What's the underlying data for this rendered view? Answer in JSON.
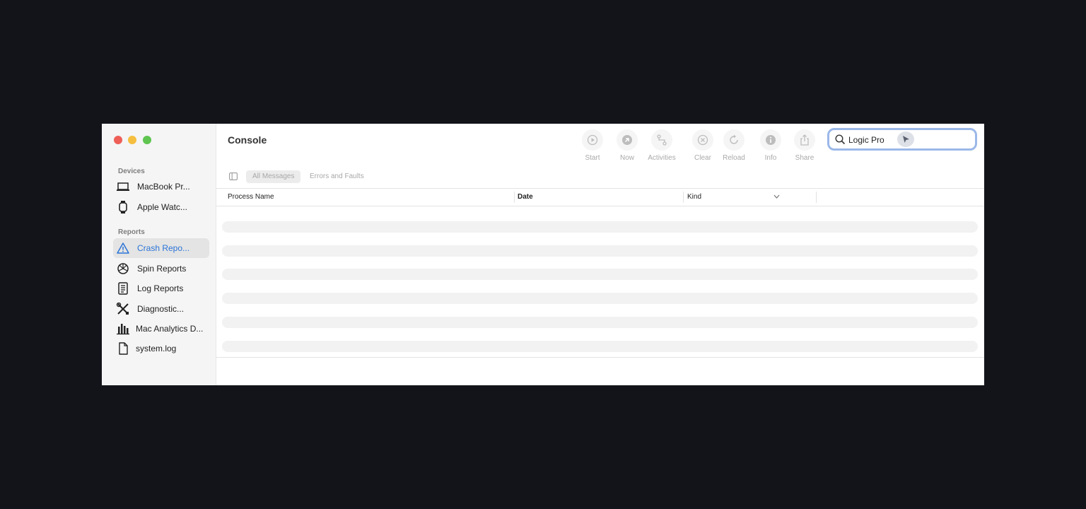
{
  "window": {
    "title": "Console"
  },
  "sidebar": {
    "devices_label": "Devices",
    "devices": [
      {
        "label": "MacBook Pr...",
        "icon": "laptop-icon"
      },
      {
        "label": "Apple Watc...",
        "icon": "watch-icon"
      }
    ],
    "reports_label": "Reports",
    "reports": [
      {
        "label": "Crash Repo...",
        "icon": "warning-triangle-icon",
        "selected": true
      },
      {
        "label": "Spin Reports",
        "icon": "spin-wheel-icon"
      },
      {
        "label": "Log Reports",
        "icon": "document-list-icon"
      },
      {
        "label": "Diagnostic...",
        "icon": "tools-icon"
      },
      {
        "label": "Mac Analytics D...",
        "icon": "bar-chart-icon"
      },
      {
        "label": "system.log",
        "icon": "file-icon"
      }
    ]
  },
  "toolbar": {
    "start": "Start",
    "now": "Now",
    "activities": "Activities",
    "clear": "Clear",
    "reload": "Reload",
    "info": "Info",
    "share": "Share"
  },
  "search": {
    "value": "Logic Pro"
  },
  "filters": {
    "all_messages": "All Messages",
    "errors_and_faults": "Errors and Faults"
  },
  "table": {
    "columns": [
      "Process Name",
      "Date",
      "Kind"
    ],
    "sorted_column": "Date"
  },
  "colors": {
    "accent": "#2b74d6",
    "close": "#ee5f58",
    "minimize": "#f5be3f",
    "maximize": "#5fc550",
    "search_focus": "#9bb8e8",
    "background": "#131419"
  }
}
